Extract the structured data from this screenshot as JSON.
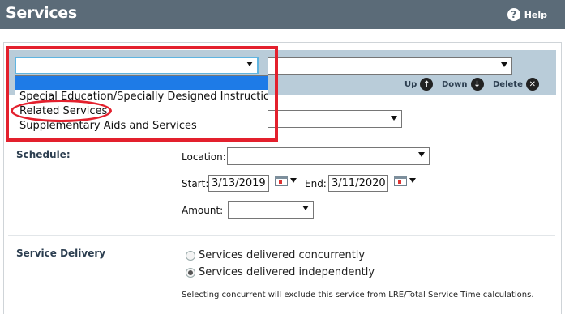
{
  "header": {
    "title": "Services",
    "help_label": "Help",
    "help_icon_glyph": "?"
  },
  "toolbar": {
    "primary_select_value": "",
    "secondary_select_value": "",
    "up_label": "Up",
    "down_label": "Down",
    "delete_label": "Delete",
    "up_icon_glyph": "↑",
    "down_icon_glyph": "↓",
    "delete_icon_glyph": "✕"
  },
  "dropdown": {
    "options": [
      "",
      "Special Education/Specially Designed Instruction",
      "Related Services",
      "Supplementary Aids and Services"
    ],
    "highlighted_index": 0
  },
  "schedule": {
    "section_label": "Schedule:",
    "location_label": "Location:",
    "location_value": "",
    "start_label": "Start:",
    "start_value": "3/13/2019",
    "end_label": "End:",
    "end_value": "3/11/2020",
    "amount_label": "Amount:",
    "amount_value": ""
  },
  "delivery": {
    "section_label": "Service Delivery",
    "option_concurrent": "Services delivered concurrently",
    "option_independent": "Services delivered independently",
    "selected": "independent",
    "note": "Selecting concurrent will exclude this service from LRE/Total Service Time calculations."
  },
  "colors": {
    "header_bg": "#5b6b78",
    "toolbar_bg": "#b9ccd9",
    "highlight": "#1e7be7",
    "annotation_red": "#e3202d"
  }
}
